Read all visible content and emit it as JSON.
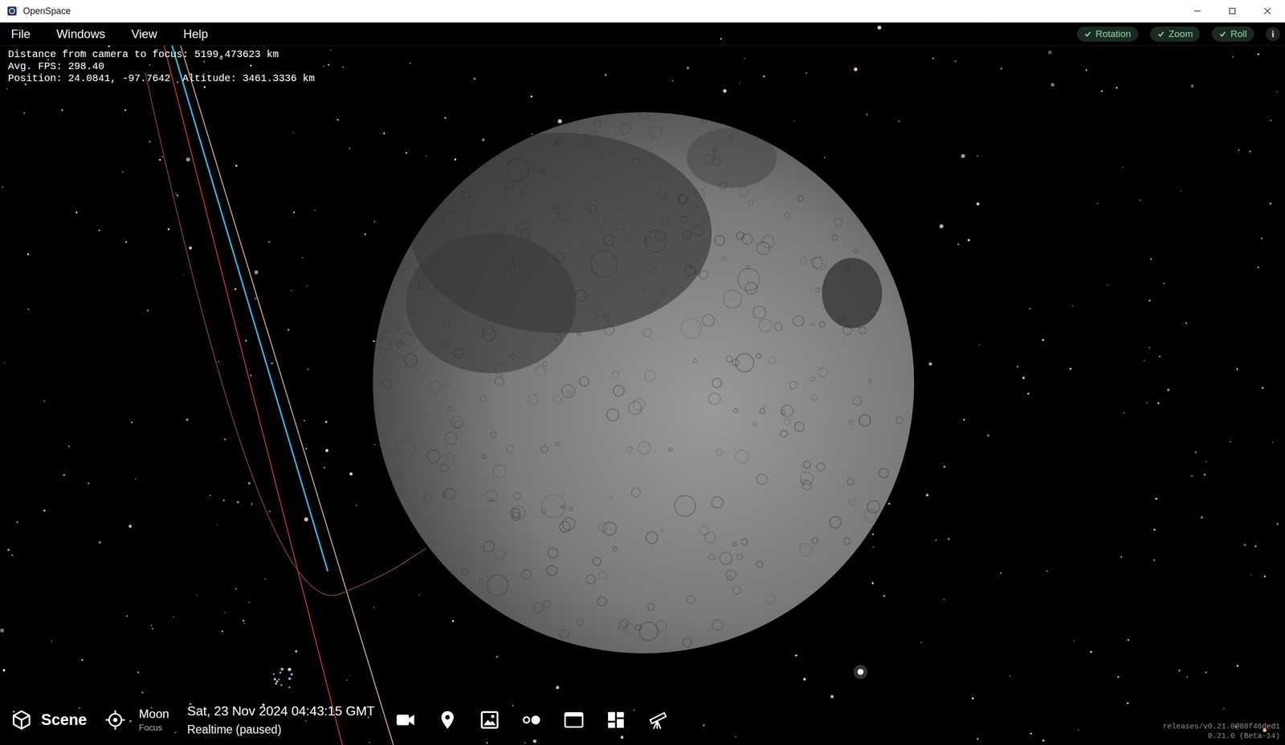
{
  "window": {
    "title": "OpenSpace"
  },
  "menu": [
    "File",
    "Windows",
    "View",
    "Help"
  ],
  "toggles": [
    {
      "label": "Rotation",
      "checked": true
    },
    {
      "label": "Zoom",
      "checked": true
    },
    {
      "label": "Roll",
      "checked": true
    }
  ],
  "info_button": "i",
  "overlay_info": [
    "Distance from camera to focus: 5199.473623 km",
    "Avg. FPS: 298.40",
    "Position: 24.0841, -97.7642  Altitude: 3461.3336 km"
  ],
  "scene": {
    "label": "Scene"
  },
  "focus": {
    "name": "Moon",
    "label": "Focus"
  },
  "time": {
    "date": "Sat, 23 Nov 2024 04:43:15 GMT",
    "mode": "Realtime (paused)"
  },
  "trails": [
    {
      "color": "#39b6e6"
    },
    {
      "color": "#c0392b"
    },
    {
      "color": "#c8a89c"
    },
    {
      "color": "#7a3a33"
    }
  ],
  "version": [
    "releases/v0.21.0@80f46ded1",
    "0.21.0 (Beta-14)"
  ]
}
